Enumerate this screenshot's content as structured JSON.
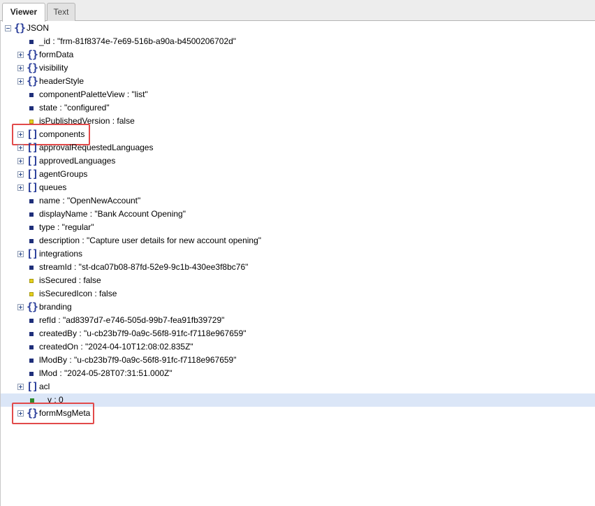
{
  "tabs": {
    "viewer": "Viewer",
    "text": "Text"
  },
  "tree": {
    "root": "JSON",
    "rows": [
      {
        "label": "_id : \"frm-81f8374e-7e69-516b-a90a-b4500206702d\""
      },
      {
        "label": "formData"
      },
      {
        "label": "visibility"
      },
      {
        "label": "headerStyle"
      },
      {
        "label": "componentPaletteView : \"list\""
      },
      {
        "label": "state : \"configured\""
      },
      {
        "label": "isPublishedVersion : false"
      },
      {
        "label": "components"
      },
      {
        "label": "approvalRequestedLanguages"
      },
      {
        "label": "approvedLanguages"
      },
      {
        "label": "agentGroups"
      },
      {
        "label": "queues"
      },
      {
        "label": "name : \"OpenNewAccount\""
      },
      {
        "label": "displayName : \"Bank Account Opening\""
      },
      {
        "label": "type : \"regular\""
      },
      {
        "label": "description : \"Capture user details for new account opening\""
      },
      {
        "label": "integrations"
      },
      {
        "label": "streamId : \"st-dca07b08-87fd-52e9-9c1b-430ee3f8bc76\""
      },
      {
        "label": "isSecured : false"
      },
      {
        "label": "isSecuredIcon : false"
      },
      {
        "label": "branding"
      },
      {
        "label": "refId : \"ad8397d7-e746-505d-99b7-fea91fb39729\""
      },
      {
        "label": "createdBy : \"u-cb23b7f9-0a9c-56f8-91fc-f7118e967659\""
      },
      {
        "label": "createdOn : \"2024-04-10T12:08:02.835Z\""
      },
      {
        "label": "lModBy : \"u-cb23b7f9-0a9c-56f8-91fc-f7118e967659\""
      },
      {
        "label": "lMod : \"2024-05-28T07:31:51.000Z\""
      },
      {
        "label": "acl"
      },
      {
        "label": "v : 0"
      },
      {
        "label": "formMsgMeta"
      }
    ]
  }
}
